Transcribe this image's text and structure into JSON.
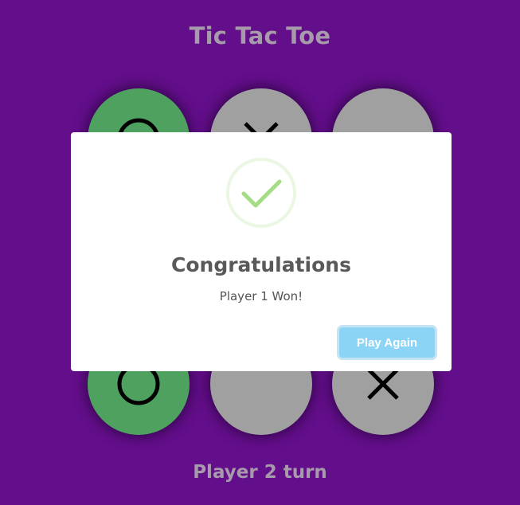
{
  "game": {
    "title": "Tic Tac Toe",
    "status": "Player 2 turn"
  },
  "board": [
    {
      "row": 1,
      "col": 1,
      "mark": "O",
      "highlight": true
    },
    {
      "row": 1,
      "col": 2,
      "mark": "X",
      "highlight": false
    },
    {
      "row": 1,
      "col": 3,
      "mark": "",
      "highlight": false
    },
    {
      "row": 3,
      "col": 1,
      "mark": "O",
      "highlight": true
    },
    {
      "row": 3,
      "col": 2,
      "mark": "",
      "highlight": false
    },
    {
      "row": 3,
      "col": 3,
      "mark": "X",
      "highlight": false
    }
  ],
  "modal": {
    "icon": "success-check-icon",
    "title": "Congratulations",
    "message": "Player 1 Won!",
    "button_label": "Play Again"
  },
  "colors": {
    "background": "#630e8a",
    "cell": "#a0a0a0",
    "winning_cell": "#4fa160",
    "mark": "#000000",
    "button": "#8cd4f5",
    "check": "#a5dc86"
  }
}
